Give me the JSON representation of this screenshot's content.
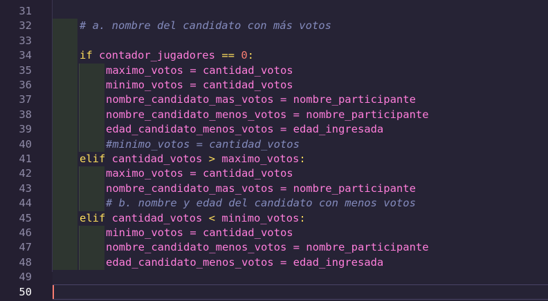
{
  "colors": {
    "background": "#262335",
    "keyword": "#fede5d",
    "identifier": "#ff7edb",
    "number": "#f97e72",
    "comment": "#848bbd",
    "caret": "#f97e72"
  },
  "editor": {
    "active_line": "50",
    "lines": [
      {
        "num": "31",
        "indent": 0,
        "tokens": []
      },
      {
        "num": "32",
        "indent": 1,
        "tokens": [
          {
            "t": "# a. nombre del candidato con más votos",
            "c": "cm"
          }
        ]
      },
      {
        "num": "33",
        "indent": 1,
        "tokens": []
      },
      {
        "num": "34",
        "indent": 1,
        "tokens": [
          {
            "t": "if",
            "c": "kw"
          },
          {
            "t": " contador_jugadores ",
            "c": "var"
          },
          {
            "t": "==",
            "c": "op"
          },
          {
            "t": " ",
            "c": "var"
          },
          {
            "t": "0",
            "c": "num"
          },
          {
            "t": ":",
            "c": "op"
          }
        ]
      },
      {
        "num": "35",
        "indent": 2,
        "tokens": [
          {
            "t": "maximo_votos = cantidad_votos",
            "c": "var"
          }
        ]
      },
      {
        "num": "36",
        "indent": 2,
        "tokens": [
          {
            "t": "minimo_votos = cantidad_votos",
            "c": "var"
          }
        ]
      },
      {
        "num": "37",
        "indent": 2,
        "tokens": [
          {
            "t": "nombre_candidato_mas_votos = nombre_participante",
            "c": "var"
          }
        ]
      },
      {
        "num": "38",
        "indent": 2,
        "tokens": [
          {
            "t": "nombre_candidato_menos_votos = nombre_participante",
            "c": "var"
          }
        ]
      },
      {
        "num": "39",
        "indent": 2,
        "tokens": [
          {
            "t": "edad_candidato_menos_votos = edad_ingresada",
            "c": "var"
          }
        ]
      },
      {
        "num": "40",
        "indent": 2,
        "tokens": [
          {
            "t": "#minimo_votos = cantidad_votos",
            "c": "cm"
          }
        ]
      },
      {
        "num": "41",
        "indent": 1,
        "tokens": [
          {
            "t": "elif",
            "c": "kw"
          },
          {
            "t": " cantidad_votos ",
            "c": "var"
          },
          {
            "t": ">",
            "c": "op"
          },
          {
            "t": " maximo_votos",
            "c": "var"
          },
          {
            "t": ":",
            "c": "op"
          }
        ]
      },
      {
        "num": "42",
        "indent": 2,
        "tokens": [
          {
            "t": "maximo_votos = cantidad_votos",
            "c": "var"
          }
        ]
      },
      {
        "num": "43",
        "indent": 2,
        "tokens": [
          {
            "t": "nombre_candidato_mas_votos = nombre_participante",
            "c": "var"
          }
        ]
      },
      {
        "num": "44",
        "indent": 2,
        "tokens": [
          {
            "t": "# b. nombre y edad del candidato con menos votos",
            "c": "cm"
          }
        ]
      },
      {
        "num": "45",
        "indent": 1,
        "tokens": [
          {
            "t": "elif",
            "c": "kw"
          },
          {
            "t": " cantidad_votos ",
            "c": "var"
          },
          {
            "t": "<",
            "c": "op"
          },
          {
            "t": " minimo_votos",
            "c": "var"
          },
          {
            "t": ":",
            "c": "op"
          }
        ]
      },
      {
        "num": "46",
        "indent": 2,
        "tokens": [
          {
            "t": "minimo_votos = cantidad_votos",
            "c": "var"
          }
        ]
      },
      {
        "num": "47",
        "indent": 2,
        "tokens": [
          {
            "t": "nombre_candidato_menos_votos = nombre_participante",
            "c": "var"
          }
        ]
      },
      {
        "num": "48",
        "indent": 2,
        "tokens": [
          {
            "t": "edad_candidato_menos_votos = edad_ingresada",
            "c": "var"
          }
        ]
      },
      {
        "num": "49",
        "indent": 0,
        "tokens": []
      },
      {
        "num": "50",
        "indent": 0,
        "tokens": []
      }
    ]
  }
}
